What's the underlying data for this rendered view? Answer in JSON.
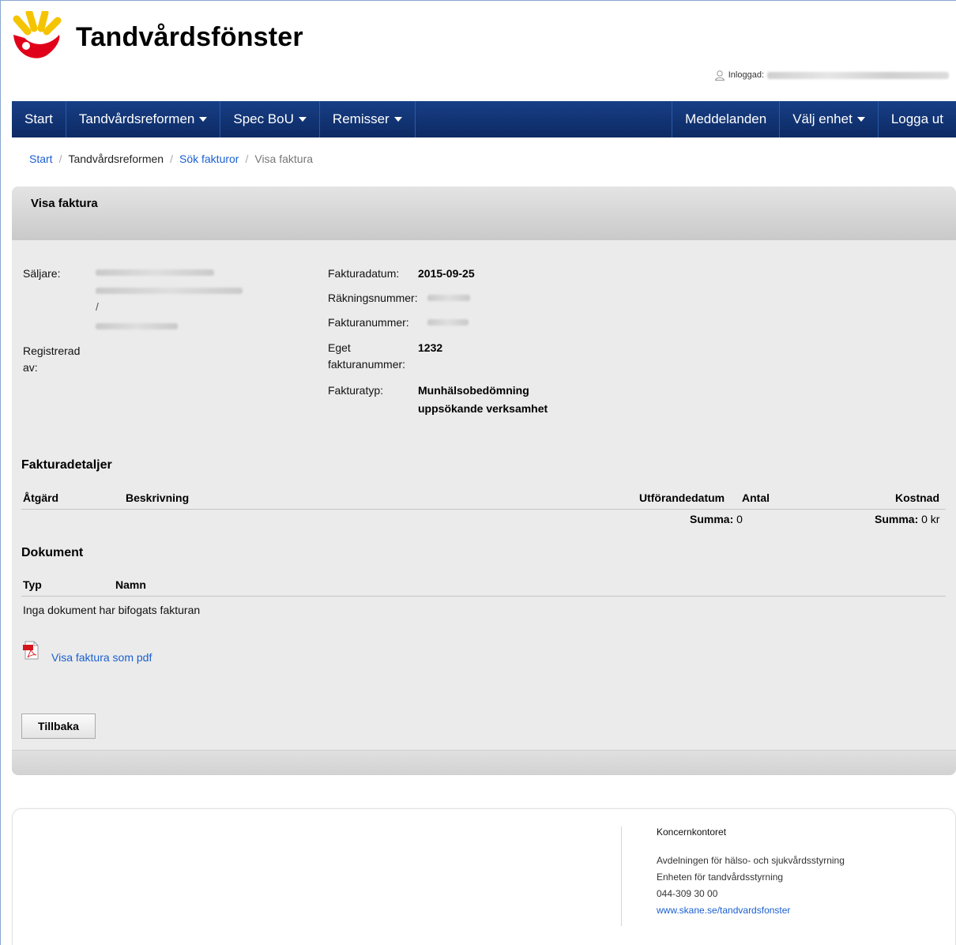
{
  "header": {
    "site_title": "Tandvårdsfönster",
    "logged_in_label": "Inloggad:"
  },
  "nav": {
    "items": [
      {
        "label": "Start"
      },
      {
        "label": "Tandvårdsreformen"
      },
      {
        "label": "Spec BoU"
      },
      {
        "label": "Remisser"
      }
    ],
    "right_items": [
      {
        "label": "Meddelanden"
      },
      {
        "label": "Välj enhet"
      },
      {
        "label": "Logga ut"
      }
    ]
  },
  "breadcrumb": {
    "items": [
      "Start",
      "Tandvårdsreformen",
      "Sök fakturor",
      "Visa faktura"
    ]
  },
  "panel": {
    "title": "Visa faktura",
    "seller_label": "Säljare:",
    "seller_line3": "/",
    "registered_label": "Registrerad av:",
    "invoice_date_label": "Fakturadatum:",
    "invoice_date_value": "2015-09-25",
    "bill_number_label": "Räkningsnummer:",
    "invoice_number_label": "Fakturanummer:",
    "own_invoice_number_label": "Eget fakturanummer:",
    "own_invoice_number_value": "1232",
    "invoice_type_label": "Fakturatyp:",
    "invoice_type_value": "Munhälsobedömning uppsökande verksamhet"
  },
  "details": {
    "title": "Fakturadetaljer",
    "columns": [
      "Åtgärd",
      "Beskrivning",
      "Utförandedatum",
      "Antal",
      "Kostnad"
    ],
    "sum_label": "Summa:",
    "sum_count": "0",
    "sum_cost_label": "Summa:",
    "sum_cost": "0 kr"
  },
  "documents": {
    "title": "Dokument",
    "columns": [
      "Typ",
      "Namn"
    ],
    "empty_text": "Inga dokument har bifogats fakturan",
    "pdf_link": "Visa faktura som pdf"
  },
  "actions": {
    "back_label": "Tillbaka"
  },
  "footer": {
    "org": "Koncernkontoret",
    "line1": "Avdelningen för hälso- och sjukvårdsstyrning",
    "line2": "Enheten för tandvårdsstyrning",
    "phone": "044-309 30 00",
    "link": "www.skane.se/tandvardsfonster"
  }
}
